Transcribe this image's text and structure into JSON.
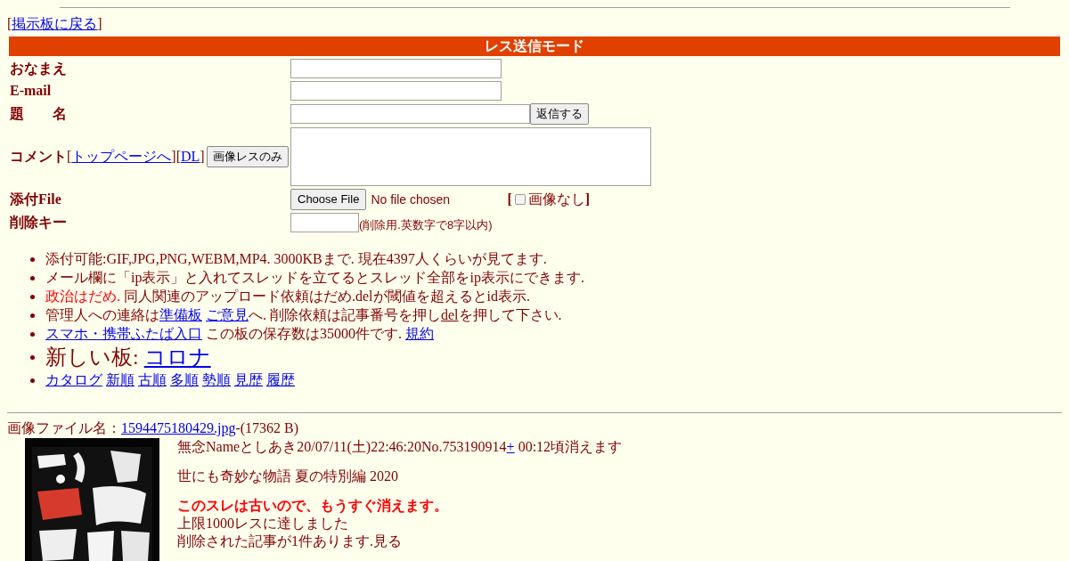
{
  "back_nav": [
    {
      "kind": "text",
      "text": "["
    },
    {
      "kind": "link",
      "text": "掲示板に戻る"
    },
    {
      "kind": "text",
      "text": "]"
    }
  ],
  "form": {
    "title": "レス送信モード",
    "name_label": "おなまえ",
    "email_label": "E-mail",
    "subject_label": "題　　名",
    "submit_button": "返信する",
    "comment_label": [
      {
        "kind": "label",
        "text": "コメント"
      },
      {
        "kind": "text",
        "text": "["
      },
      {
        "kind": "link",
        "text": "トップページへ"
      },
      {
        "kind": "text",
        "text": "]["
      },
      {
        "kind": "link",
        "text": "DL"
      },
      {
        "kind": "text",
        "text": "]"
      }
    ],
    "image_only_button": "画像レスのみ",
    "file_label": "添付File",
    "file_button": "Choose File",
    "file_status": "No file chosen",
    "no_image": {
      "open": "[",
      "label": "画像なし",
      "close": "]",
      "checked": false
    },
    "delete_key_label": "削除キー",
    "delete_key_hint": "(削除用.英数字で8字以内)"
  },
  "notices": [
    {
      "kind": "normal",
      "segments": [
        {
          "kind": "text",
          "text": "添付可能:GIF,JPG,PNG,WEBM,MP4. 3000KBまで. 現在4397人くらいが見てます."
        }
      ]
    },
    {
      "kind": "normal",
      "segments": [
        {
          "kind": "text",
          "text": "メール欄に「ip表示」と入れてスレッドを立てるとスレッド全部をip表示にできます."
        }
      ]
    },
    {
      "kind": "normal",
      "segments": [
        {
          "kind": "warn",
          "text": "政治はだめ."
        },
        {
          "kind": "text",
          "text": " 同人関連のアップロード依頼はだめ.delが閾値を超えるとid表示."
        }
      ]
    },
    {
      "kind": "normal",
      "segments": [
        {
          "kind": "text",
          "text": "管理人への連絡は"
        },
        {
          "kind": "link",
          "text": "準備板"
        },
        {
          "kind": "link",
          "text": "ご意見"
        },
        {
          "kind": "text",
          "text": "へ. 削除依頼は記事番号を押し"
        },
        {
          "kind": "dellink",
          "text": "del"
        },
        {
          "kind": "text",
          "text": "を押して下さい."
        }
      ]
    },
    {
      "kind": "normal",
      "segments": [
        {
          "kind": "link",
          "text": "スマホ・携帯ふたば入口"
        },
        {
          "kind": "text",
          "text": " この板の保存数は35000件です. "
        },
        {
          "kind": "link",
          "text": "規約"
        }
      ]
    },
    {
      "kind": "large",
      "segments": [
        {
          "kind": "text",
          "text": "新しい板: "
        },
        {
          "kind": "link",
          "text": "コロナ"
        }
      ]
    },
    {
      "kind": "normal",
      "segments": [
        {
          "kind": "link",
          "text": "カタログ"
        },
        {
          "kind": "link",
          "text": "新順"
        },
        {
          "kind": "link",
          "text": "古順"
        },
        {
          "kind": "link",
          "text": "多順"
        },
        {
          "kind": "link",
          "text": "勢順"
        },
        {
          "kind": "link",
          "text": "見歴"
        },
        {
          "kind": "link",
          "text": "履歴"
        }
      ]
    }
  ],
  "post": {
    "file_label": "画像ファイル名：",
    "file_link": "1594475180429.jpg",
    "file_size": "-(17362 B)",
    "thumbnail": {
      "kind": "picture"
    },
    "header": [
      {
        "kind": "text",
        "text": "無念Nameとしあき20/07/11(土)22:46:20No.753190914"
      },
      {
        "kind": "link",
        "text": "+"
      },
      {
        "kind": "text",
        "text": " 00:12頃消えます"
      }
    ],
    "title": "世にも奇妙な物語 夏の特別編 2020",
    "warning": "このスレは古いので、もうすぐ消えます。",
    "lines": [
      "上限1000レスに達しました",
      "削除された記事が1件あります.見る"
    ]
  }
}
